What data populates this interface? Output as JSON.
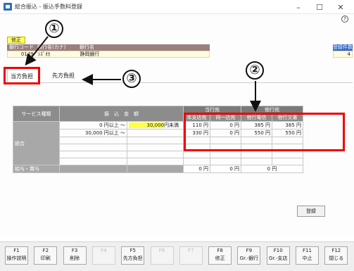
{
  "window": {
    "title": "総合振込 - 振込手数料登録",
    "minimize": "–",
    "maximize": "☐",
    "close": "✕",
    "help": "?"
  },
  "info": {
    "mode": "修正",
    "headers": [
      "銀行コード",
      "銀行名(カナ)",
      "銀行名"
    ],
    "values": [
      "0149",
      "ｼｽﾞｵｶ",
      "静岡銀行"
    ],
    "count_label": "登録件数",
    "count_value": "4"
  },
  "tabs": [
    {
      "label": "当方負担"
    },
    {
      "label": "先方負担"
    }
  ],
  "table": {
    "service_header": "サービス種類",
    "amount_header": "振　込　金　額",
    "group1": "当行宛",
    "group2": "他行宛",
    "sub_headers": [
      "本支店宛",
      "同一店宛",
      "他行電信",
      "他行文書"
    ],
    "rows": [
      {
        "from": "0 円以上 ～",
        "to": "30,000",
        "to_suffix": "円未満",
        "v1": "110 円",
        "v2": "0 円",
        "v3": "385 円",
        "v4": "385 円"
      },
      {
        "from": "30,000 円以上 ～",
        "to": "",
        "to_suffix": "",
        "v1": "330 円",
        "v2": "0 円",
        "v3": "550 円",
        "v4": "550 円"
      }
    ],
    "category_label": "総合",
    "footer_label": "給与・賞与",
    "footer_values": [
      "0 円",
      "0 円",
      "0 円"
    ]
  },
  "buttons": {
    "register": "登録"
  },
  "fkeys": [
    {
      "key": "F1",
      "label": "操作説明",
      "enabled": true
    },
    {
      "key": "F2",
      "label": "印刷",
      "enabled": true
    },
    {
      "key": "F3",
      "label": "削除",
      "enabled": true
    },
    {
      "key": "F4",
      "label": "",
      "enabled": false
    },
    {
      "key": "F5",
      "label": "先方負担",
      "enabled": true
    },
    {
      "key": "F6",
      "label": "",
      "enabled": false
    },
    {
      "key": "F7",
      "label": "",
      "enabled": false
    },
    {
      "key": "F8",
      "label": "修正",
      "enabled": true
    },
    {
      "key": "F9",
      "label": "Gr.-銀行",
      "enabled": true
    },
    {
      "key": "F10",
      "label": "Gr.-支店",
      "enabled": true
    },
    {
      "key": "F11",
      "label": "中止",
      "enabled": true
    },
    {
      "key": "F12",
      "label": "閉じる",
      "enabled": true
    }
  ],
  "annotations": [
    "①",
    "②",
    "③"
  ],
  "colors": {
    "annotation_red": "#e00000",
    "info_header": "#9a7f80",
    "count_header": "#3064c8",
    "input_highlight": "#ffff44"
  }
}
